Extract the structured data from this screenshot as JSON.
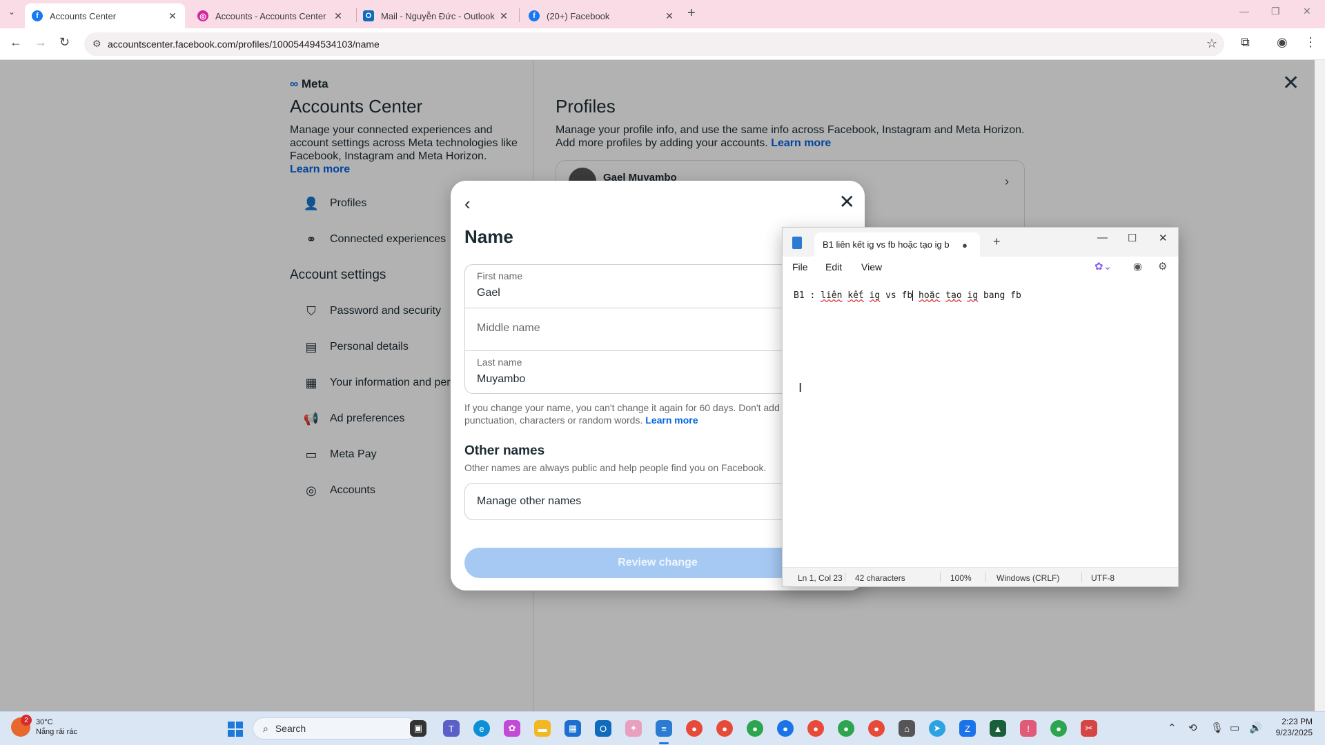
{
  "browser": {
    "tabs": [
      {
        "title": "Accounts Center",
        "icon": "facebook-icon",
        "active": true
      },
      {
        "title": "Accounts - Accounts Center",
        "icon": "instagram-icon",
        "active": false
      },
      {
        "title": "Mail - Nguyễn Đức - Outlook",
        "icon": "outlook-icon",
        "active": false
      },
      {
        "title": "(20+) Facebook",
        "icon": "facebook-icon",
        "active": false
      }
    ],
    "url": "accountscenter.facebook.com/profiles/100054494534103/name"
  },
  "page": {
    "brand": "Meta",
    "title": "Accounts Center",
    "description": "Manage your connected experiences and account settings across Meta technologies like Facebook, Instagram and Meta Horizon.",
    "learn_more": "Learn more",
    "nav_top": [
      {
        "label": "Profiles",
        "icon": "profile-icon"
      },
      {
        "label": "Connected experiences",
        "icon": "connected-icon"
      }
    ],
    "account_settings_heading": "Account settings",
    "nav_settings": [
      {
        "label": "Password and security",
        "icon": "shield-icon"
      },
      {
        "label": "Personal details",
        "icon": "id-card-icon"
      },
      {
        "label": "Your information and per",
        "icon": "info-doc-icon"
      },
      {
        "label": "Ad preferences",
        "icon": "megaphone-icon"
      },
      {
        "label": "Meta Pay",
        "icon": "card-icon"
      },
      {
        "label": "Accounts",
        "icon": "account-circle-icon"
      }
    ],
    "profiles_title": "Profiles",
    "profiles_desc": "Manage your profile info, and use the same info across Facebook, Instagram and Meta Horizon. Add more profiles by adding your accounts.",
    "profile_name": "Gael Muyambo"
  },
  "modal": {
    "title": "Name",
    "first_name_label": "First name",
    "first_name_value": "Gael",
    "middle_name_placeholder": "Middle name",
    "last_name_label": "Last name",
    "last_name_value": "Muyambo",
    "note": "If you change your name, you can't change it again for 60 days. Don't add a capitalization, punctuation, characters or random words.",
    "note_link": "Learn more",
    "other_names_title": "Other names",
    "other_names_desc": "Other names are always public and help people find you on Facebook.",
    "manage_other_names": "Manage other names",
    "review_button": "Review change"
  },
  "notepad": {
    "tab_title": "B1  liên kết ig vs fb hoặc tạo ig b",
    "menu": [
      "File",
      "Edit",
      "View"
    ],
    "text_plain_1": "B1 : ",
    "text_sq_1": "liên",
    "text_sq_2": "kết",
    "text_sq_3": "ig",
    "text_plain_2": " vs fb",
    "text_sq_4": "hoặc",
    "text_sq_5": "tạo",
    "text_sq_6": "ig",
    "text_plain_3": " bang fb",
    "status": {
      "position": "Ln 1, Col 23",
      "chars": "42 characters",
      "zoom": "100%",
      "eol": "Windows (CRLF)",
      "encoding": "UTF-8"
    }
  },
  "taskbar": {
    "weather_temp": "30°C",
    "weather_desc": "Nắng rải rác",
    "weather_badge": "2",
    "search_label": "Search",
    "time": "2:23 PM",
    "date": "9/23/2025"
  }
}
